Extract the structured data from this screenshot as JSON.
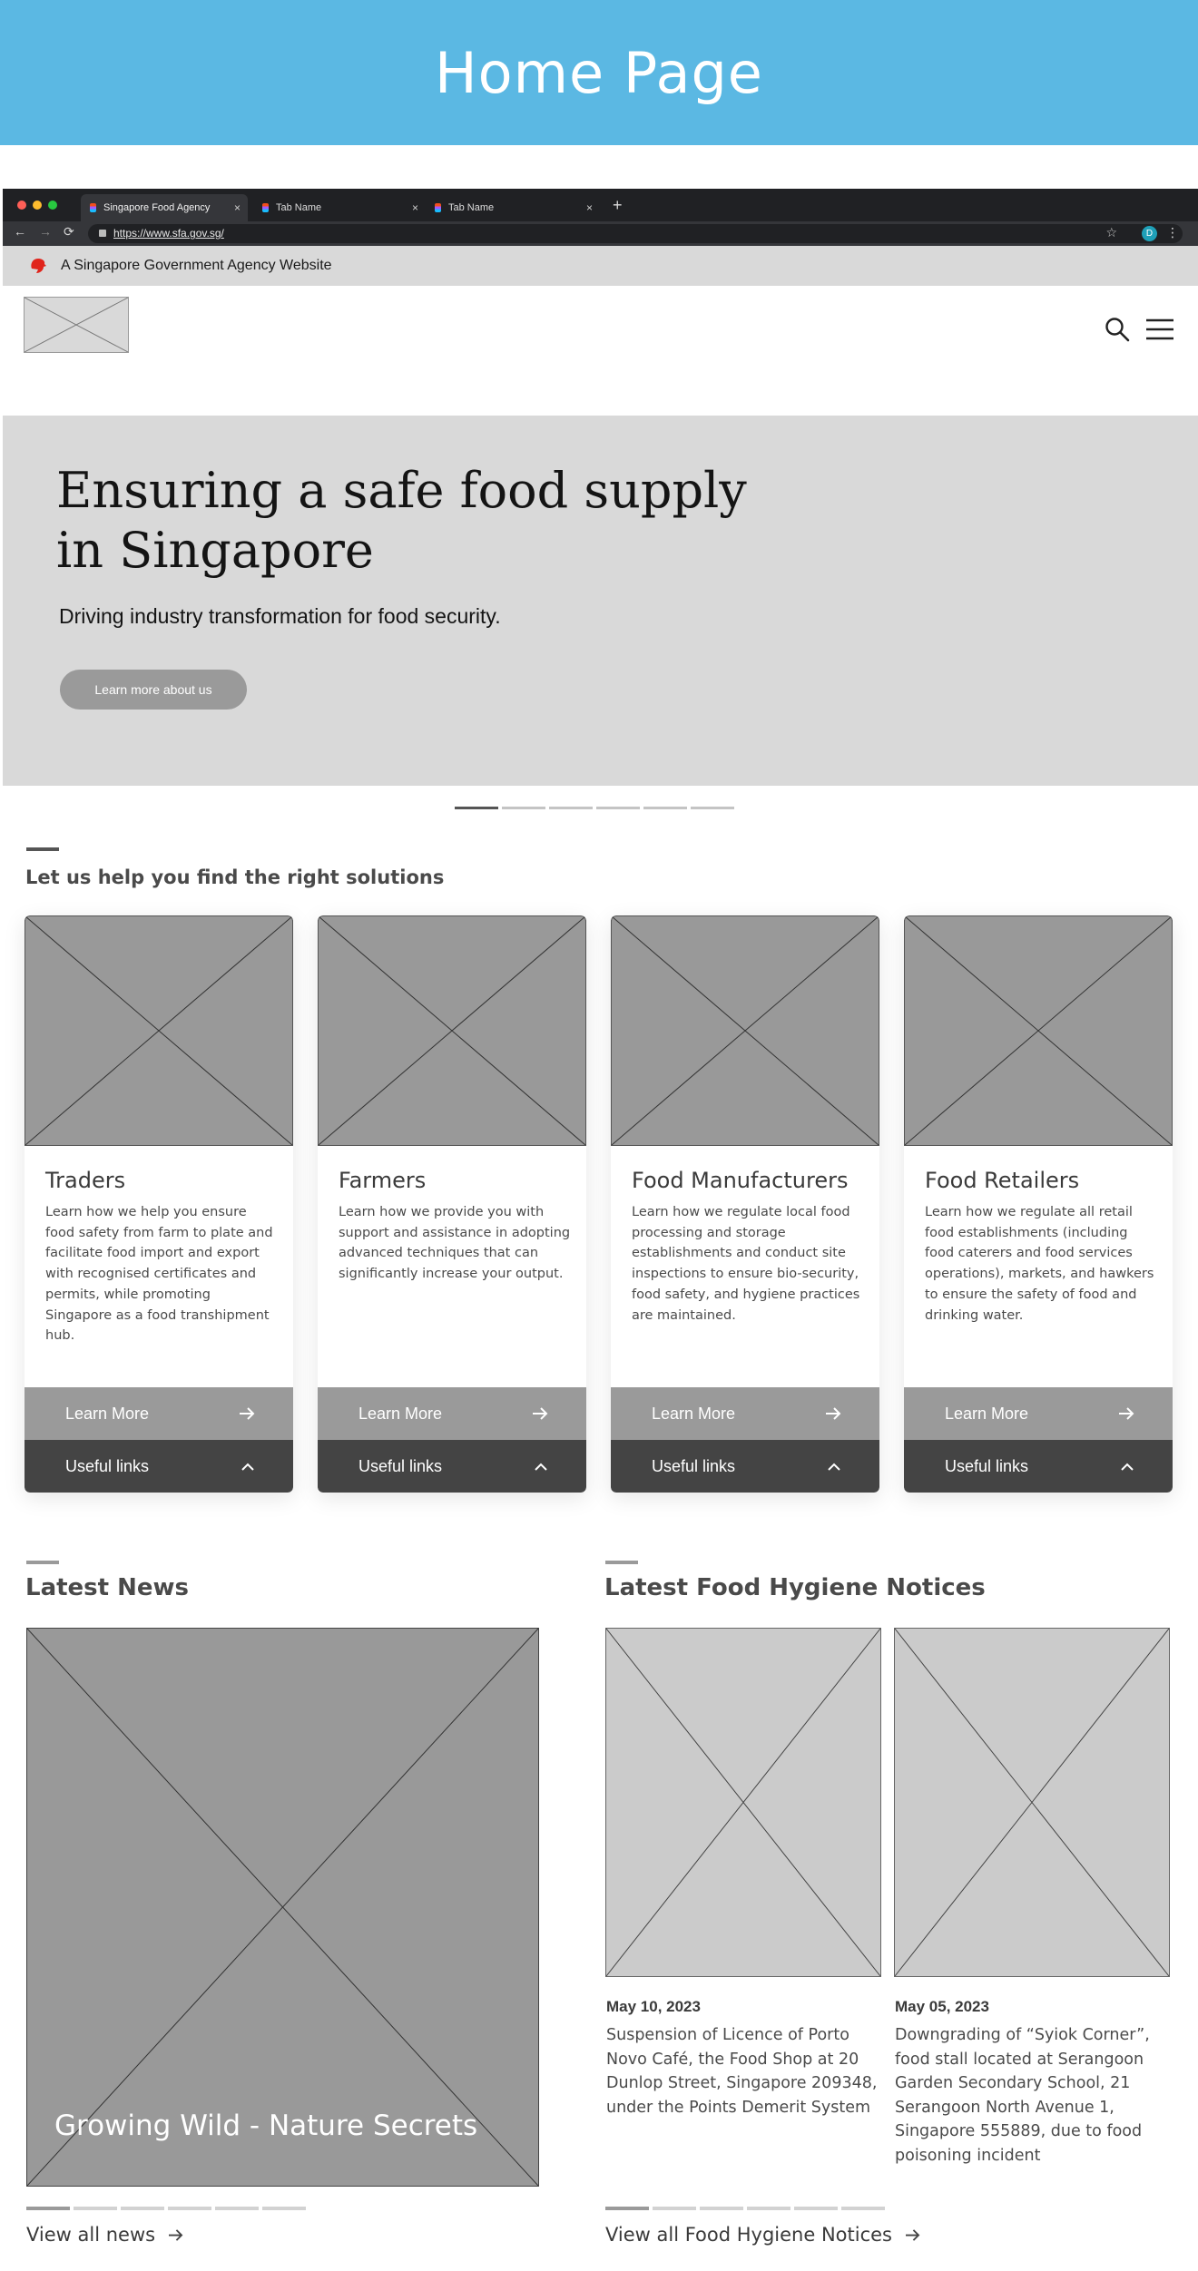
{
  "banner": {
    "title": "Home Page"
  },
  "browser": {
    "tabs": [
      {
        "label": "Singapore Food Agency",
        "close": "×"
      },
      {
        "label": "Tab Name",
        "close": "×"
      },
      {
        "label": "Tab Name",
        "close": "×"
      }
    ],
    "new_tab": "+",
    "url": "https://www.sfa.gov.sg/",
    "profile_initial": "D",
    "controls": {
      "back": "←",
      "forward": "→",
      "reload": "⟳",
      "star": "☆",
      "menu": "⋮"
    }
  },
  "gov_bar": {
    "text": "A Singapore Government Agency Website"
  },
  "hero": {
    "heading": "Ensuring a safe food supply in Singapore",
    "subheading": "Driving industry transformation for food security.",
    "button": "Learn more about us",
    "slides": 6,
    "active_slide": 1
  },
  "solutions": {
    "title": "Let us help you find the right solutions",
    "cards": [
      {
        "title": "Traders",
        "desc": "Learn how we help you ensure food safety from farm to plate and facilitate food import and export with recognised certificates and permits, while promoting Singapore as a food transhipment hub.",
        "learn": "Learn More",
        "useful": "Useful links"
      },
      {
        "title": "Farmers",
        "desc": "Learn how we provide you with support and assistance in adopting advanced techniques that can significantly increase your output.",
        "learn": "Learn More",
        "useful": "Useful links"
      },
      {
        "title": "Food Manufacturers",
        "desc": "Learn how we regulate local food processing and storage establishments and conduct site inspections to ensure bio-security, food safety, and hygiene practices are maintained.",
        "learn": "Learn More",
        "useful": "Useful links"
      },
      {
        "title": "Food Retailers",
        "desc": "Learn how we regulate all retail food establishments (including food caterers and food services operations), markets, and hawkers to ensure the safety of food and drinking water.",
        "learn": "Learn More",
        "useful": "Useful links"
      }
    ]
  },
  "news": {
    "title": "Latest News",
    "caption": "Growing Wild - Nature Secrets",
    "view_all": "View all news",
    "slides": 6,
    "active_slide": 1
  },
  "notices": {
    "title": "Latest Food Hygiene Notices",
    "items": [
      {
        "date": "May 10, 2023",
        "text": "Suspension of Licence of Porto Novo Café, the Food Shop at 20 Dunlop Street, Singapore 209348, under the Points Demerit System"
      },
      {
        "date": "May 05, 2023",
        "text": "Downgrading of “Syiok Corner”, food stall located at Serangoon Garden Secondary School, 21 Serangoon North Avenue 1, Singapore 555889, due to food poisoning incident"
      }
    ],
    "view_all": "View all Food Hygiene Notices",
    "slides": 6,
    "active_slide": 1
  },
  "colors": {
    "banner": "#5bb8e3",
    "hero_bg": "#d9d9d9",
    "button_grey": "#9a9a9a",
    "dark_bar": "#444444",
    "profile": "#1fa0b8"
  }
}
